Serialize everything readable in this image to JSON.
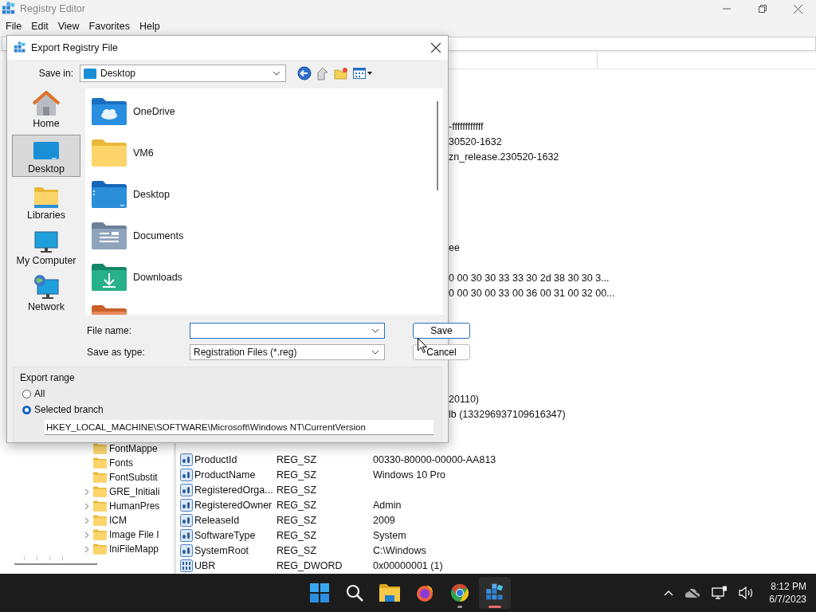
{
  "window": {
    "title": "Registry Editor"
  },
  "menu": [
    "File",
    "Edit",
    "View",
    "Favorites",
    "Help"
  ],
  "tree": {
    "items": [
      {
        "label": "FontMappe",
        "expandable": false
      },
      {
        "label": "Fonts",
        "expandable": false
      },
      {
        "label": "FontSubstit",
        "expandable": false
      },
      {
        "label": "GRE_Initiali",
        "expandable": true
      },
      {
        "label": "HumanPres",
        "expandable": true
      },
      {
        "label": "ICM",
        "expandable": true
      },
      {
        "label": "Image File I",
        "expandable": true
      },
      {
        "label": "IniFileMapp",
        "expandable": true
      }
    ]
  },
  "values": {
    "covered_rows": [
      {
        "data": "-ffffffffffff"
      },
      {
        "data": "30520-1632"
      },
      {
        "data": "zn_release.230520-1632"
      },
      {},
      {},
      {},
      {},
      {},
      {
        "data": "ee"
      },
      {},
      {
        "data": "0 00 30 30 33 33 30 2d 38 30 30 3..."
      },
      {
        "data": "0 00 30 00 33 00 36 00 31 00 32 00..."
      },
      {},
      {},
      {},
      {},
      {},
      {},
      {
        "data": "20110)"
      },
      {
        "data": "lb (133296937109616347)"
      },
      {},
      {}
    ],
    "rows": [
      {
        "name": "ProductId",
        "type": "REG_SZ",
        "data": "00330-80000-00000-AA813",
        "kind": "string"
      },
      {
        "name": "ProductName",
        "type": "REG_SZ",
        "data": "Windows 10 Pro",
        "kind": "string"
      },
      {
        "name": "RegisteredOrga...",
        "type": "REG_SZ",
        "kind": "string"
      },
      {
        "name": "RegisteredOwner",
        "type": "REG_SZ",
        "data": "Admin",
        "kind": "string"
      },
      {
        "name": "ReleaseId",
        "type": "REG_SZ",
        "data": "2009",
        "kind": "string"
      },
      {
        "name": "SoftwareType",
        "type": "REG_SZ",
        "data": "System",
        "kind": "string"
      },
      {
        "name": "SystemRoot",
        "type": "REG_SZ",
        "data": "C:\\Windows",
        "kind": "string"
      },
      {
        "name": "UBR",
        "type": "REG_DWORD",
        "data": "0x00000001 (1)",
        "kind": "number"
      }
    ]
  },
  "dialog": {
    "title": "Export Registry File",
    "save_in": {
      "label": "Save in:",
      "value": "Desktop"
    },
    "places": [
      {
        "label": "Home",
        "kind": "home",
        "selected": false
      },
      {
        "label": "Desktop",
        "kind": "desktop",
        "selected": true
      },
      {
        "label": "Libraries",
        "kind": "libraries",
        "selected": false
      },
      {
        "label": "My Computer",
        "kind": "computer",
        "selected": false
      },
      {
        "label": "Network",
        "kind": "network",
        "selected": false
      }
    ],
    "files": [
      {
        "name": "OneDrive",
        "kind": "cloud"
      },
      {
        "name": "VM6",
        "kind": "folder"
      },
      {
        "name": "Desktop",
        "kind": "desktop"
      },
      {
        "name": "Documents",
        "kind": "documents"
      },
      {
        "name": "Downloads",
        "kind": "downloads"
      },
      {
        "kind": "pictures"
      }
    ],
    "file_name": {
      "label": "File name:"
    },
    "save_type": {
      "label": "Save as type:",
      "value": "Registration Files (*.reg)"
    },
    "buttons": [
      {
        "label": "Save",
        "default": true
      },
      {
        "label": "Cancel",
        "default": false
      }
    ],
    "export_range": {
      "title": "Export range",
      "options": [
        {
          "label": "All",
          "selected": false
        },
        {
          "label": "Selected branch",
          "selected": true
        }
      ],
      "branch_path": "HKEY_LOCAL_MACHINE\\SOFTWARE\\Microsoft\\Windows NT\\CurrentVersion"
    }
  },
  "taskbar": {
    "apps": [
      {
        "kind": "start",
        "running": false,
        "active": false
      },
      {
        "kind": "search",
        "running": false,
        "active": false
      },
      {
        "kind": "explorer",
        "running": false,
        "active": false
      },
      {
        "kind": "firefox",
        "running": false,
        "active": false
      },
      {
        "kind": "chrome",
        "running": true,
        "active": false
      },
      {
        "kind": "regedit",
        "running": true,
        "active": true
      }
    ],
    "time": "8:12 PM",
    "date": "6/7/2023"
  }
}
